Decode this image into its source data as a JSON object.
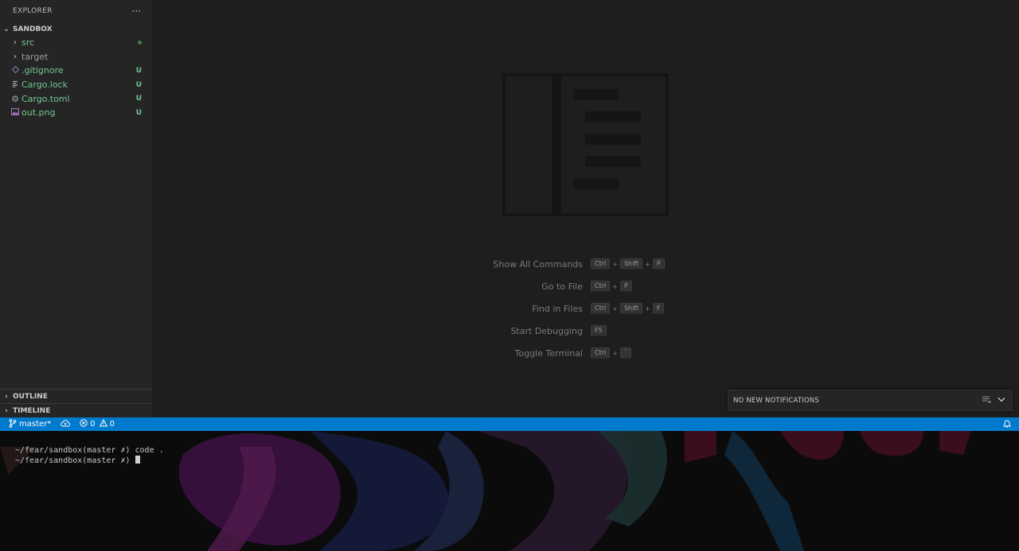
{
  "sidebar": {
    "title": "EXPLORER",
    "more": "···",
    "section": "SANDBOX",
    "items": [
      {
        "label": "src",
        "kind": "folder",
        "status": "",
        "icon": "chevron-right-icon"
      },
      {
        "label": "target",
        "kind": "folder",
        "status": "",
        "icon": "chevron-right-icon"
      },
      {
        "label": ".gitignore",
        "kind": "file",
        "status": "U",
        "icon": "git-file-icon"
      },
      {
        "label": "Cargo.lock",
        "kind": "file",
        "status": "U",
        "icon": "lines-file-icon"
      },
      {
        "label": "Cargo.toml",
        "kind": "file",
        "status": "U",
        "icon": "gear-icon"
      },
      {
        "label": "out.png",
        "kind": "file",
        "status": "U",
        "icon": "image-icon"
      }
    ],
    "outline": "OUTLINE",
    "timeline": "TIMELINE"
  },
  "editor": {
    "shortcuts": [
      {
        "label": "Show All Commands",
        "keys": [
          "Ctrl",
          "Shift",
          "P"
        ]
      },
      {
        "label": "Go to File",
        "keys": [
          "Ctrl",
          "P"
        ]
      },
      {
        "label": "Find in Files",
        "keys": [
          "Ctrl",
          "Shift",
          "F"
        ]
      },
      {
        "label": "Start Debugging",
        "keys": [
          "F5"
        ]
      },
      {
        "label": "Toggle Terminal",
        "keys": [
          "Ctrl",
          "`"
        ]
      }
    ]
  },
  "notifications": {
    "text": "NO NEW NOTIFICATIONS"
  },
  "statusbar": {
    "branch": "master*",
    "errors": "0",
    "warnings": "0"
  },
  "terminal": {
    "line1": "~/fear/sandbox(master ✗) code .",
    "line2": "~/fear/sandbox(master ✗) "
  },
  "colors": {
    "accent": "#007acc",
    "untracked": "#73c991",
    "sidebar_bg": "#252526",
    "editor_bg": "#1e1e1e"
  }
}
